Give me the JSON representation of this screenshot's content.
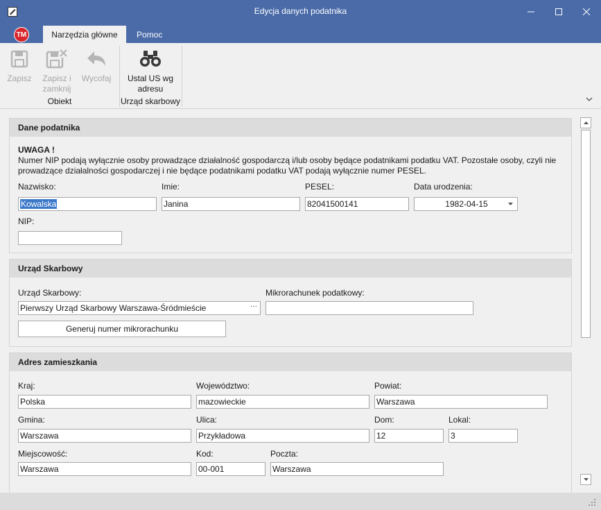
{
  "window": {
    "title": "Edycja danych podatnika"
  },
  "ribbon": {
    "logo_text": "TM",
    "tabs": [
      {
        "label": "Narzędzia główne"
      },
      {
        "label": "Pomoc"
      }
    ],
    "buttons": {
      "save": "Zapisz",
      "save_close": "Zapisz i zamknij",
      "undo": "Wycofaj",
      "set_office": "Ustal US wg adresu"
    },
    "groups": {
      "object": "Obiekt",
      "tax_office": "Urząd skarbowy"
    }
  },
  "taxpayer": {
    "header": "Dane podatnika",
    "warning_title": "UWAGA !",
    "warning_text": "Numer NIP podają wyłącznie osoby prowadzące działalność gospodarczą i/lub osoby będące podatnikami podatku VAT. Pozostałe osoby, czyli nie prowadzące działalności gospodarczej i nie będące podatnikami podatku VAT podają wyłącznie numer PESEL.",
    "surname_label": "Nazwisko:",
    "surname": "Kowalska",
    "name_label": "Imie:",
    "name": "Janina",
    "pesel_label": "PESEL:",
    "pesel": "82041500141",
    "birth_label": "Data urodzenia:",
    "birth": "1982-04-15",
    "nip_label": "NIP:",
    "nip": ""
  },
  "office": {
    "header": "Urząd Skarbowy",
    "office_label": "Urząd Skarbowy:",
    "office_value": "Pierwszy Urząd Skarbowy Warszawa-Śródmieście",
    "micro_label": "Mikrorachunek podatkowy:",
    "micro_value": "",
    "generate_button": "Generuj numer mikrorachunku"
  },
  "address": {
    "header": "Adres zamieszkania",
    "country_label": "Kraj:",
    "country": "Polska",
    "voivodeship_label": "Województwo:",
    "voivodeship": "mazowieckie",
    "county_label": "Powiat:",
    "county": "Warszawa",
    "commune_label": "Gmina:",
    "commune": "Warszawa",
    "street_label": "Ulica:",
    "street": "Przykładowa",
    "house_label": "Dom:",
    "house": "12",
    "flat_label": "Lokal:",
    "flat": "3",
    "city_label": "Miejscowość:",
    "city": "Warszawa",
    "postal_label": "Kod:",
    "postal": "00-001",
    "post_label": "Poczta:",
    "post": "Warszawa"
  },
  "colors": {
    "titlebar": "#4a6ba8",
    "selection": "#3a77c8",
    "logo": "#d8262c"
  }
}
